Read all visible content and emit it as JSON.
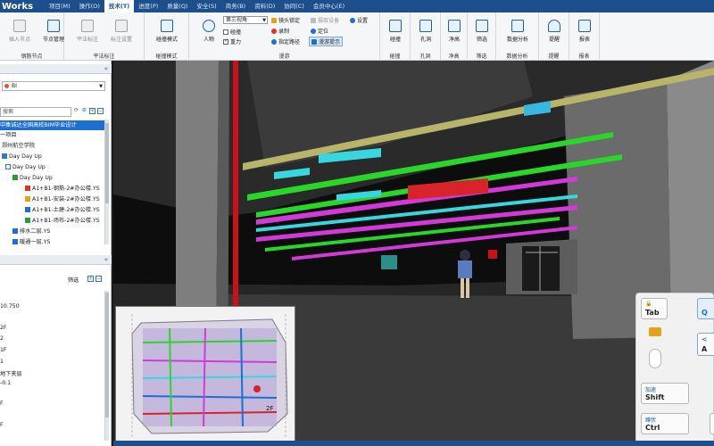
{
  "menubar": {
    "logo": "Works",
    "tabs": [
      "项目(M)",
      "操作(O)",
      "技术(T)",
      "进度(P)",
      "质量(Q)",
      "安全(S)",
      "商务(B)",
      "资料(D)",
      "协同(C)",
      "会员中心(E)"
    ],
    "active_index": 2
  },
  "ribbon": {
    "groups": {
      "steel": {
        "title": "钢筋节点",
        "btn1": "插入节点",
        "btn2": "节点管理"
      },
      "plane": {
        "title": "平法标注",
        "btn1": "平法标注",
        "btn2": "标注设置"
      },
      "collide": {
        "title": "碰撞模式",
        "btn1": "碰撞模式"
      },
      "roam": {
        "title": "漫游",
        "person": "人物",
        "view_select": "第三视角",
        "collide_chk": "碰撞",
        "gravity_chk": "重力",
        "lock_view": "镜头锁定",
        "record": "录制",
        "set_path": "指定路径",
        "capture_device": "摄取设备",
        "locate": "定位",
        "collide_tip": "漫游提示",
        "settings": "设置"
      },
      "collision": {
        "title": "碰撞",
        "btn": "碰撞"
      },
      "hole": {
        "title": "孔洞",
        "btn": "孔洞"
      },
      "clearance": {
        "title": "净高",
        "btn": "净高"
      },
      "filter": {
        "title": "筛选",
        "btn": "筛选"
      },
      "data": {
        "title": "数据分析",
        "btn": "数据分析"
      },
      "remind": {
        "title": "提醒",
        "btn": "提醒"
      },
      "report": {
        "title": "报表",
        "btn": "报表"
      }
    }
  },
  "left": {
    "dropdown": "BI",
    "search_placeholder": "搜索",
    "tree": [
      "中集诚达全国高校BIM毕业设计",
      "一项目",
      "郑州航空学院",
      "Day Day Up",
      "Day Day Up",
      "Day Day Up",
      "A1+B1-钢筋-2#办公楼.YS",
      "A1+B1-安装-2#办公楼.YS",
      "A1+B1-土建-2#办公楼.YS",
      "A1+B1-场布-2#办公楼.YS",
      "排水二层.YS",
      "暖通一层.YS"
    ],
    "filter_label": "筛选",
    "props": [
      "10.750",
      "2F",
      "2",
      "1F",
      "1",
      "地下夹层",
      "-0.1",
      "",
      "F",
      "",
      "F"
    ]
  },
  "minimap": {
    "floor_label": "2F"
  },
  "keypad": {
    "tab": {
      "top": "",
      "main": "Tab"
    },
    "q": {
      "top": "",
      "main": "Q"
    },
    "a": {
      "top": "",
      "main": "A"
    },
    "shift": {
      "top": "加速",
      "main": "Shift"
    },
    "ctrl": {
      "top": "蹲伏",
      "main": "Ctrl"
    }
  },
  "colors": {
    "accent": "#1d4f8c",
    "highlight": "#1d6fd1",
    "pipe_yellow": "#b8b46a",
    "pipe_green": "#2bd62b",
    "pipe_magenta": "#d23ad8",
    "pipe_cyan": "#38d7e0",
    "pipe_red": "#c8121a"
  }
}
